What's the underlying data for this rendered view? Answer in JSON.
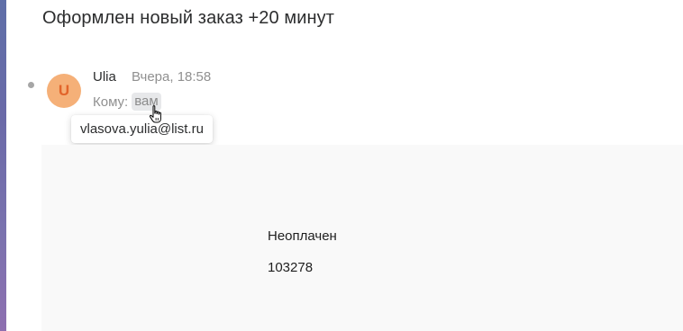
{
  "email": {
    "subject": "Оформлен новый заказ +20 минут",
    "sender": {
      "avatar_letter": "U",
      "name": "Ulia",
      "date": "Вчера, 18:58"
    },
    "recipient": {
      "label": "Кому:",
      "value": "вам",
      "tooltip_email": "vlasova.yulia@list.ru"
    },
    "body": {
      "status": "Неоплачен",
      "order_number": "103278"
    }
  },
  "colors": {
    "avatar_bg": "#f5b078",
    "avatar_text": "#e2642a",
    "unread_dot": "#a6a6a6",
    "body_bg": "#f9f9f9"
  },
  "icons": {
    "cursor": "hand-pointer-icon"
  }
}
